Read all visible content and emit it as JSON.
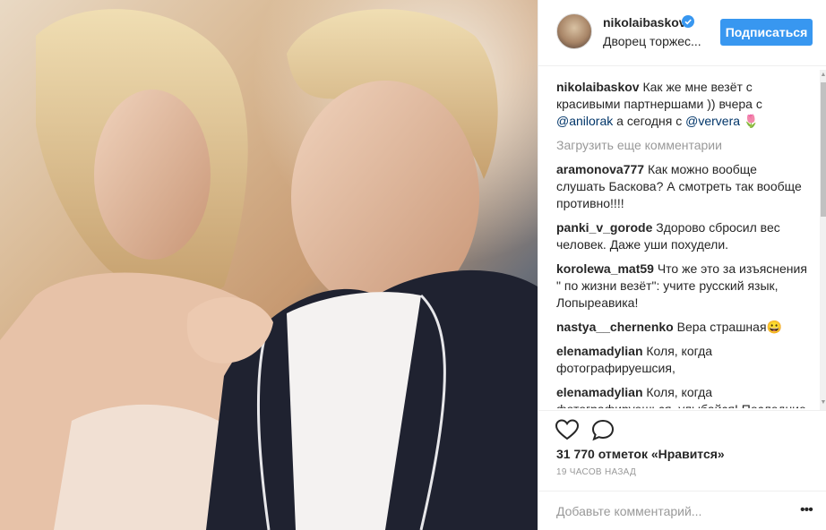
{
  "post": {
    "username": "nikolaibaskov",
    "location": "Дворец торжес...",
    "follow_label": "Подписаться",
    "likes": "31 770 отметок «Нравится»",
    "time": "19 ЧАСОВ НАЗАД",
    "add_comment_placeholder": "Добавьте комментарий...",
    "more_label": "•••"
  },
  "caption": {
    "user": "nikolaibaskov",
    "text_part1": " Как же мне везёт с красивыми партнершами )) вчера с ",
    "mention1": "@anilorak",
    "text_part2": " а сегодня с ",
    "mention2": "@ververa",
    "text_part3": " 🌷"
  },
  "load_more": "Загрузить еще комментарии",
  "comments": [
    {
      "user": "aramonova777",
      "text": " Как можно вообще слушать Баскова? А смотреть так вообще противно!!!!"
    },
    {
      "user": "panki_v_gorode",
      "text": " Здорово сбросил вес человек. Даже уши похудели."
    },
    {
      "user": "korolewa_mat59",
      "text": " Что же это за изъяснения \" по жизни везёт\": учите русский язык, Лопыреавика!"
    },
    {
      "user": "nastya__chernenko",
      "text": " Вера страшная😀"
    },
    {
      "user": "elenamadylian",
      "text": " Коля, когда фотографируешсия,"
    },
    {
      "user": "elenamadylian",
      "text": " Коля, когда фотографируешься, улыбайся! Последние твои снимки везде с"
    }
  ],
  "icons": {
    "verified": "verified-badge-icon",
    "heart": "heart-icon",
    "comment": "comment-icon"
  },
  "colors": {
    "accent": "#3897f0",
    "mention": "#003569",
    "muted": "#999999"
  }
}
